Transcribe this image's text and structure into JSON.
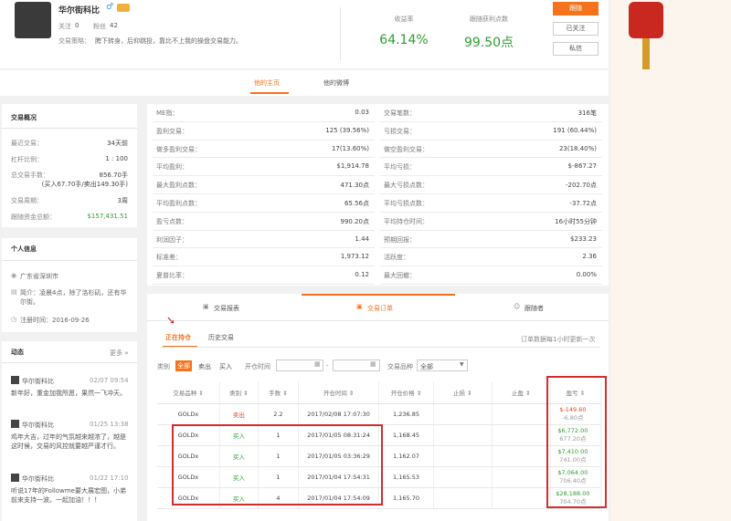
{
  "profile": {
    "name": "华尔街科比",
    "gender": "♂",
    "follow_label": "关注",
    "follow_count": "0",
    "fans_label": "粉丝",
    "fans_count": "42",
    "strategy_label": "交易策略：",
    "strategy_text": "胯下转身，后仰跳投，靠比不上我的操盘交易能力。"
  },
  "stats": {
    "return_label": "收益率",
    "return_value": "64.14%",
    "profit_label": "跟随获利点数",
    "profit_value": "99.50点"
  },
  "buttons": {
    "follow": "跟随",
    "followed": "已关注",
    "message": "私信"
  },
  "nav": {
    "home": "他的主页",
    "weibo": "他的微博"
  },
  "overview": {
    "title": "交易概况",
    "items": [
      {
        "k": "最近交易：",
        "v": "34天前"
      },
      {
        "k": "杠杆比例：",
        "v": "1 : 100"
      },
      {
        "k": "总交易手数：",
        "v": "856.70手"
      },
      {
        "k": "",
        "v": "(买入67.70手/卖出149.30手)"
      },
      {
        "k": "交易周期：",
        "v": "3周"
      },
      {
        "k": "跟随资金总额：",
        "v": "$157,431.51"
      }
    ]
  },
  "personal": {
    "title": "个人信息",
    "location": "广东省深圳市",
    "intro": "简介：凌晨4点，除了洛杉矶，还有华尔街。",
    "reg": "注册时间：2016-09-26"
  },
  "feed": {
    "title": "动态",
    "more": "更多 »",
    "posts": [
      {
        "user": "华尔街科比",
        "time": "02/07 09:54",
        "text": "新年好，重金加我所愿，果然一飞冲天。"
      },
      {
        "user": "华尔街科比",
        "time": "01/25 13:38",
        "text": "鸡年大吉，过年的气氛越来越浓了，越是这时候，交易的风控就要越严谨才行。"
      },
      {
        "user": "华尔街科比",
        "time": "01/22 17:10",
        "text": "听说17年的Followme要大展宏图，小弟前来支持一波。一起加油！！！"
      }
    ]
  },
  "metrics": {
    "left": [
      {
        "k": "ME指：",
        "v": "0.03"
      },
      {
        "k": "盈利交易：",
        "v": "125 (39.56%)"
      },
      {
        "k": "做多盈利交易：",
        "v": "17(13.60%)"
      },
      {
        "k": "平均盈利：",
        "v": "$1,914.78"
      },
      {
        "k": "最大盈利点数：",
        "v": "471.30点"
      },
      {
        "k": "平均盈利点数：",
        "v": "65.56点"
      },
      {
        "k": "盈亏点数：",
        "v": "990.20点"
      },
      {
        "k": "利润因子：",
        "v": "1.44"
      },
      {
        "k": "标准差：",
        "v": "1,973.12"
      },
      {
        "k": "夏普比率：",
        "v": "0.12"
      }
    ],
    "right": [
      {
        "k": "交易笔数：",
        "v": "316笔"
      },
      {
        "k": "亏损交易：",
        "v": "191 (60.44%)"
      },
      {
        "k": "做空盈利交易：",
        "v": "23(18.40%)"
      },
      {
        "k": "平均亏损：",
        "v": "$-867.27"
      },
      {
        "k": "最大亏损点数：",
        "v": "-202.70点"
      },
      {
        "k": "平均亏损点数：",
        "v": "-37.72点"
      },
      {
        "k": "平均持仓时间：",
        "v": "16小时55分钟"
      },
      {
        "k": "预期回报：",
        "v": "$233.23"
      },
      {
        "k": "活跃度：",
        "v": "2.36"
      },
      {
        "k": "最大回撤：",
        "v": "0.00%"
      }
    ]
  },
  "tabs": {
    "report": "交易报表",
    "orders": "交易订单",
    "followers": "跟随者"
  },
  "subtabs": {
    "open": "正在持仓",
    "history": "历史交易",
    "note": "订单数据每1小时更新一次"
  },
  "filter": {
    "type_label": "类别",
    "all": "全部",
    "sell": "卖出",
    "buy": "买入",
    "time_label": "开仓时间",
    "dash": "-",
    "product_label": "交易品种",
    "product_value": "全部"
  },
  "table": {
    "headers": [
      "交易品种 ⇕",
      "类别 ⇕",
      "手数 ⇕",
      "开仓时间 ⇕",
      "开仓价格 ⇕",
      "止损 ⇕",
      "止盈 ⇕",
      "盈亏 ⇕"
    ],
    "rows": [
      {
        "sym": "GOLDx",
        "type": "卖出",
        "lots": "2.2",
        "time": "2017/02/08 17:07:30",
        "price": "1,236.85",
        "pl": "$-149.60",
        "pts": "-6.80点"
      },
      {
        "sym": "GOLDx",
        "type": "买入",
        "lots": "1",
        "time": "2017/01/05 08:31:24",
        "price": "1,168.45",
        "pl": "$6,772.00",
        "pts": "677.20点"
      },
      {
        "sym": "GOLDx",
        "type": "买入",
        "lots": "1",
        "time": "2017/01/05 03:36:29",
        "price": "1,162.07",
        "pl": "$7,410.00",
        "pts": "741.00点"
      },
      {
        "sym": "GOLDx",
        "type": "买入",
        "lots": "1",
        "time": "2017/01/04 17:54:31",
        "price": "1,165.53",
        "pl": "$7,064.00",
        "pts": "706.40点"
      },
      {
        "sym": "GOLDx",
        "type": "买入",
        "lots": "4",
        "time": "2017/01/04 17:54:09",
        "price": "1,165.70",
        "pl": "$28,188.00",
        "pts": "704.70点"
      }
    ]
  },
  "colors": {
    "accent": "#f5731d",
    "green": "#2e9e30",
    "red": "#e8451e"
  }
}
